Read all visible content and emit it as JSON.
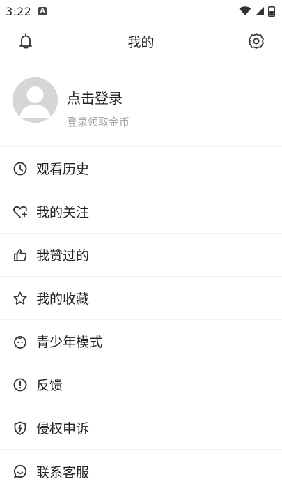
{
  "status": {
    "time": "3:22",
    "notification_badge": "A"
  },
  "header": {
    "title": "我的"
  },
  "profile": {
    "login_title": "点击登录",
    "login_subtitle": "登录领取金币"
  },
  "menu": {
    "items": [
      {
        "label": "观看历史",
        "icon": "clock-icon"
      },
      {
        "label": "我的关注",
        "icon": "heart-plus-icon"
      },
      {
        "label": "我赞过的",
        "icon": "thumbs-up-icon"
      },
      {
        "label": "我的收藏",
        "icon": "star-icon"
      },
      {
        "label": "青少年模式",
        "icon": "child-face-icon"
      },
      {
        "label": "反馈",
        "icon": "exclamation-circle-icon"
      },
      {
        "label": "侵权申诉",
        "icon": "shield-icon"
      },
      {
        "label": "联系客服",
        "icon": "chat-bubble-icon"
      }
    ]
  }
}
